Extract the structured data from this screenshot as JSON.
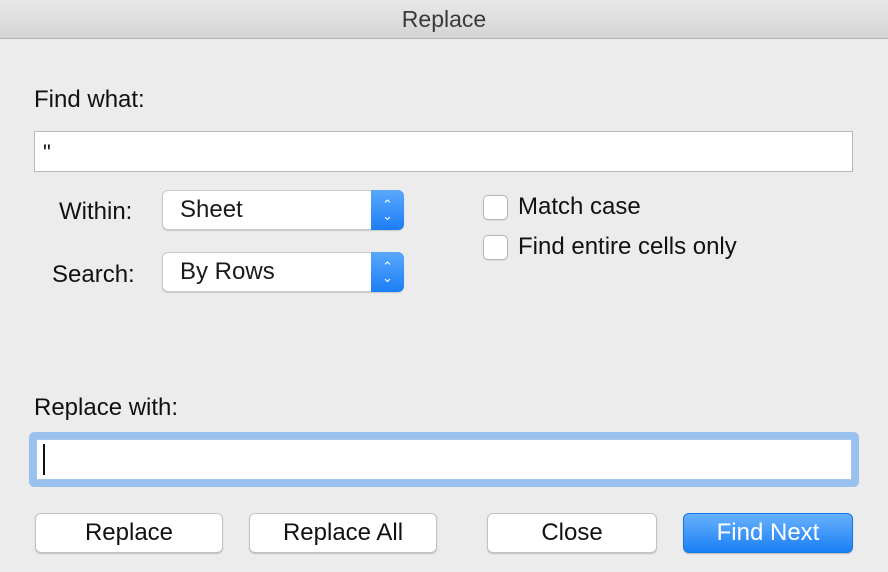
{
  "window": {
    "title": "Replace"
  },
  "find": {
    "label": "Find what:",
    "value": "\""
  },
  "options": {
    "within": {
      "label": "Within:",
      "selected": "Sheet"
    },
    "search": {
      "label": "Search:",
      "selected": "By Rows"
    },
    "stepper_up": "⌃",
    "stepper_down": "⌄"
  },
  "checkboxes": [
    {
      "label": "Match case",
      "checked": false
    },
    {
      "label": "Find entire cells only",
      "checked": false
    }
  ],
  "replace": {
    "label": "Replace with:",
    "value": ""
  },
  "buttons": {
    "replace": "Replace",
    "replace_all": "Replace All",
    "close": "Close",
    "find_next": "Find Next"
  },
  "colors": {
    "accent": "#1a7ff6",
    "focus_ring": "#98c1ee"
  }
}
